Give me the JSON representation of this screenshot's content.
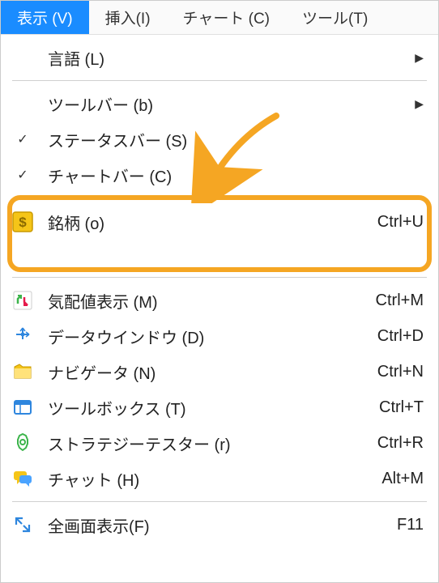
{
  "menubar": {
    "view": "表示 (V)",
    "insert": "挿入(I)",
    "chart": "チャート (C)",
    "tools": "ツール(T)"
  },
  "menu": {
    "language": {
      "label": "言語 (L)"
    },
    "toolbars": {
      "label": "ツールバー (b)"
    },
    "statusbar": {
      "label": "ステータスバー (S)"
    },
    "chartbar": {
      "label": "チャートバー (C)"
    },
    "symbols": {
      "label": "銘柄 (o)",
      "shortcut": "Ctrl+U"
    },
    "obscured": {
      "label": ""
    },
    "marketwatch": {
      "label": "気配値表示 (M)",
      "shortcut": "Ctrl+M"
    },
    "datawindow": {
      "label": "データウインドウ (D)",
      "shortcut": "Ctrl+D"
    },
    "navigator": {
      "label": "ナビゲータ (N)",
      "shortcut": "Ctrl+N"
    },
    "toolbox": {
      "label": "ツールボックス (T)",
      "shortcut": "Ctrl+T"
    },
    "strategytester": {
      "label": "ストラテジーテスター (r)",
      "shortcut": "Ctrl+R"
    },
    "chat": {
      "label": "チャット (H)",
      "shortcut": "Alt+M"
    },
    "fullscreen": {
      "label": "全画面表示(F)",
      "shortcut": "F11"
    }
  }
}
